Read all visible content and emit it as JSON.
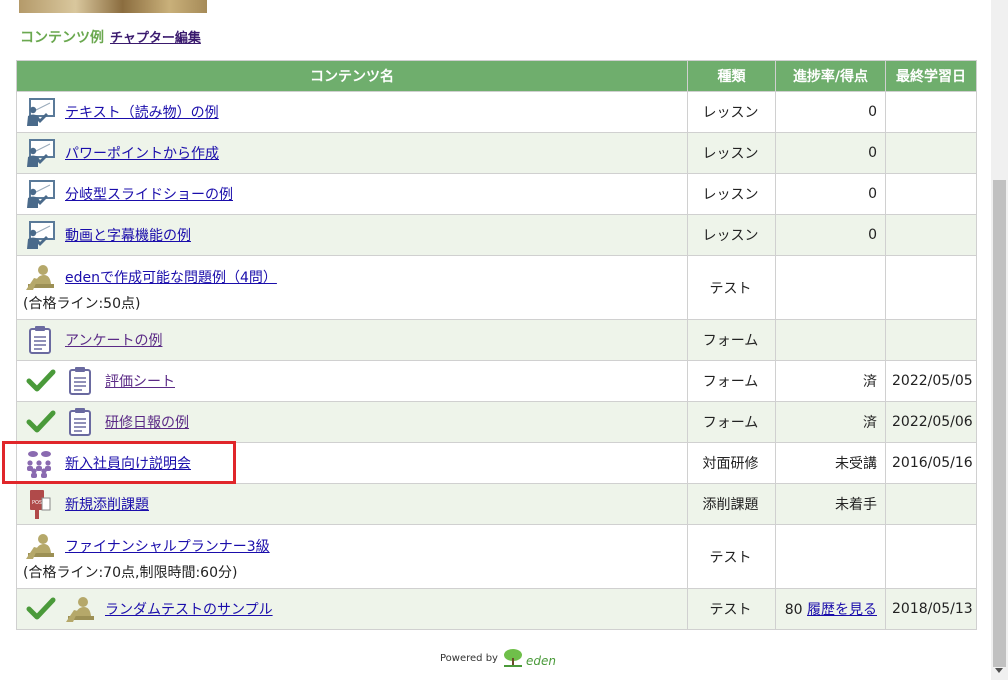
{
  "header": {
    "section_title": "コンテンツ例",
    "chapter_edit_label": "チャプター編集"
  },
  "table": {
    "columns": [
      "コンテンツ名",
      "種類",
      "進捗率/得点",
      "最終学習日"
    ],
    "rows": [
      {
        "icon": "lesson-icon",
        "title": "テキスト（読み物）の例",
        "note": "",
        "type": "レッスン",
        "progress": "0",
        "date": "",
        "done": false
      },
      {
        "icon": "lesson-icon",
        "title": "パワーポイントから作成",
        "note": "",
        "type": "レッスン",
        "progress": "0",
        "date": "",
        "done": false
      },
      {
        "icon": "lesson-icon",
        "title": "分岐型スライドショーの例",
        "note": "",
        "type": "レッスン",
        "progress": "0",
        "date": "",
        "done": false
      },
      {
        "icon": "lesson-icon",
        "title": "動画と字幕機能の例",
        "note": "",
        "type": "レッスン",
        "progress": "0",
        "date": "",
        "done": false
      },
      {
        "icon": "test-icon",
        "title": "edenで作成可能な問題例（4問）",
        "note": "(合格ライン:50点)",
        "type": "テスト",
        "progress": "",
        "date": "",
        "done": false
      },
      {
        "icon": "form-icon",
        "title": "アンケートの例",
        "note": "",
        "type": "フォーム",
        "progress": "",
        "date": "",
        "done": false
      },
      {
        "icon": "form-icon",
        "title": "評価シート",
        "note": "",
        "type": "フォーム",
        "progress": "済",
        "date": "2022/05/05",
        "done": true
      },
      {
        "icon": "form-icon",
        "title": "研修日報の例",
        "note": "",
        "type": "フォーム",
        "progress": "済",
        "date": "2022/05/06",
        "done": true
      },
      {
        "icon": "group-training-icon",
        "title": "新入社員向け説明会",
        "note": "",
        "type": "対面研修",
        "progress": "未受講",
        "date": "2016/05/16",
        "done": false
      },
      {
        "icon": "post-icon",
        "title": "新規添削課題",
        "note": "",
        "type": "添削課題",
        "progress": "未着手",
        "date": "",
        "done": false
      },
      {
        "icon": "test-icon",
        "title": "ファイナンシャルプランナー3級",
        "note": "(合格ライン:70点,制限時間:60分)",
        "type": "テスト",
        "progress": "",
        "date": "",
        "done": false
      },
      {
        "icon": "test-icon",
        "title": "ランダムテストのサンプル",
        "note": "",
        "type": "テスト",
        "progress": "80",
        "history_link": "履歴を見る",
        "date": "2018/05/13",
        "done": true
      }
    ]
  },
  "footer": {
    "powered_by": "Powered by",
    "logo_text": "eden"
  },
  "colors": {
    "header_green": "#6fae6d",
    "row_alt": "#eef4ea",
    "check_green": "#4a9a3a",
    "highlight_red": "#e0262a",
    "link_blue": "#1a0dab"
  }
}
